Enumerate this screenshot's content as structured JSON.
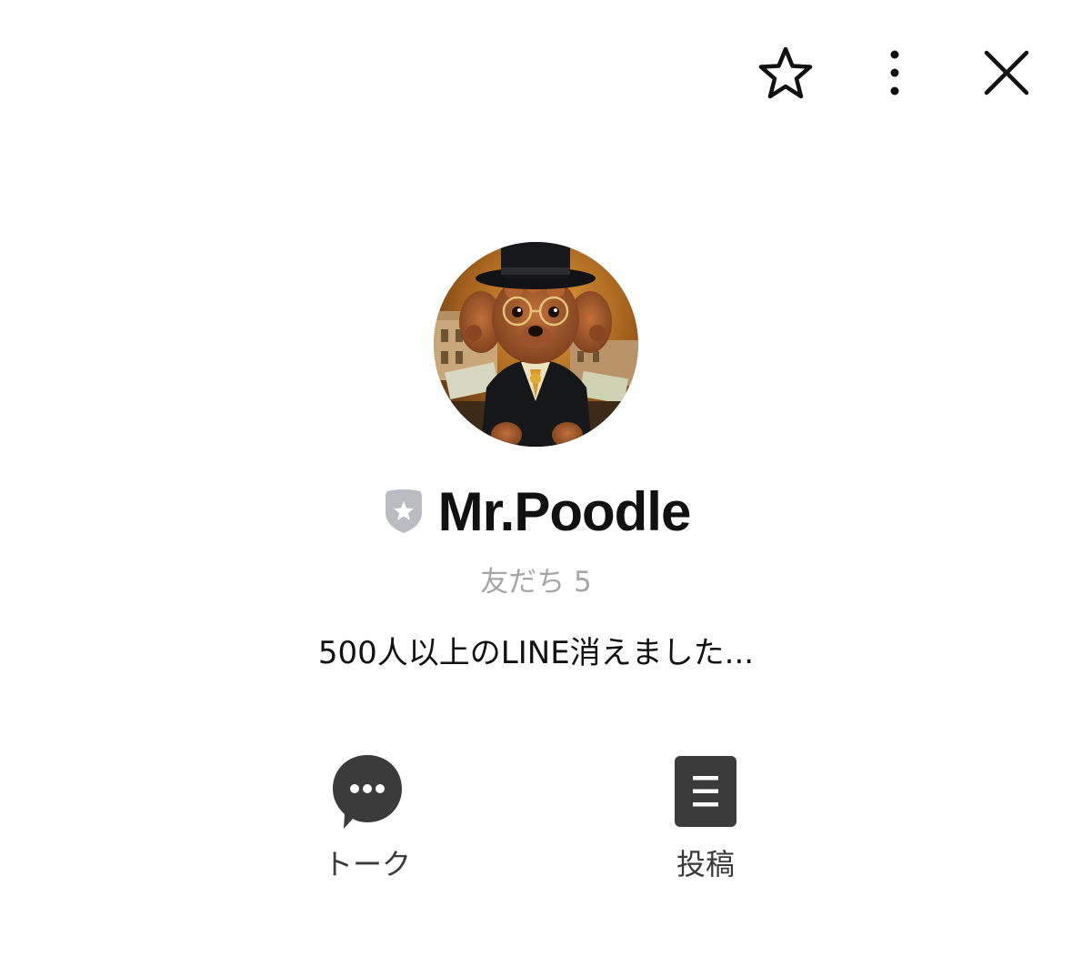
{
  "header": {
    "favorite_icon": "star-outline-icon",
    "more_icon": "vertical-ellipsis-icon",
    "close_icon": "close-x-icon"
  },
  "profile": {
    "avatar_description": "poodle-in-top-hat-avatar",
    "badge_icon": "shield-star-badge-icon",
    "name": "Mr.Poodle",
    "friends_label": "友だち 5",
    "status_message": "500人以上のLINE消えました..."
  },
  "actions": [
    {
      "label": "トーク",
      "icon": "chat-bubble-icon"
    },
    {
      "label": "投稿",
      "icon": "post-list-icon"
    }
  ],
  "colors": {
    "icon_dark": "#3b3b3b",
    "badge_gray": "#b9bcc1",
    "muted_text": "#a6a6a6"
  }
}
